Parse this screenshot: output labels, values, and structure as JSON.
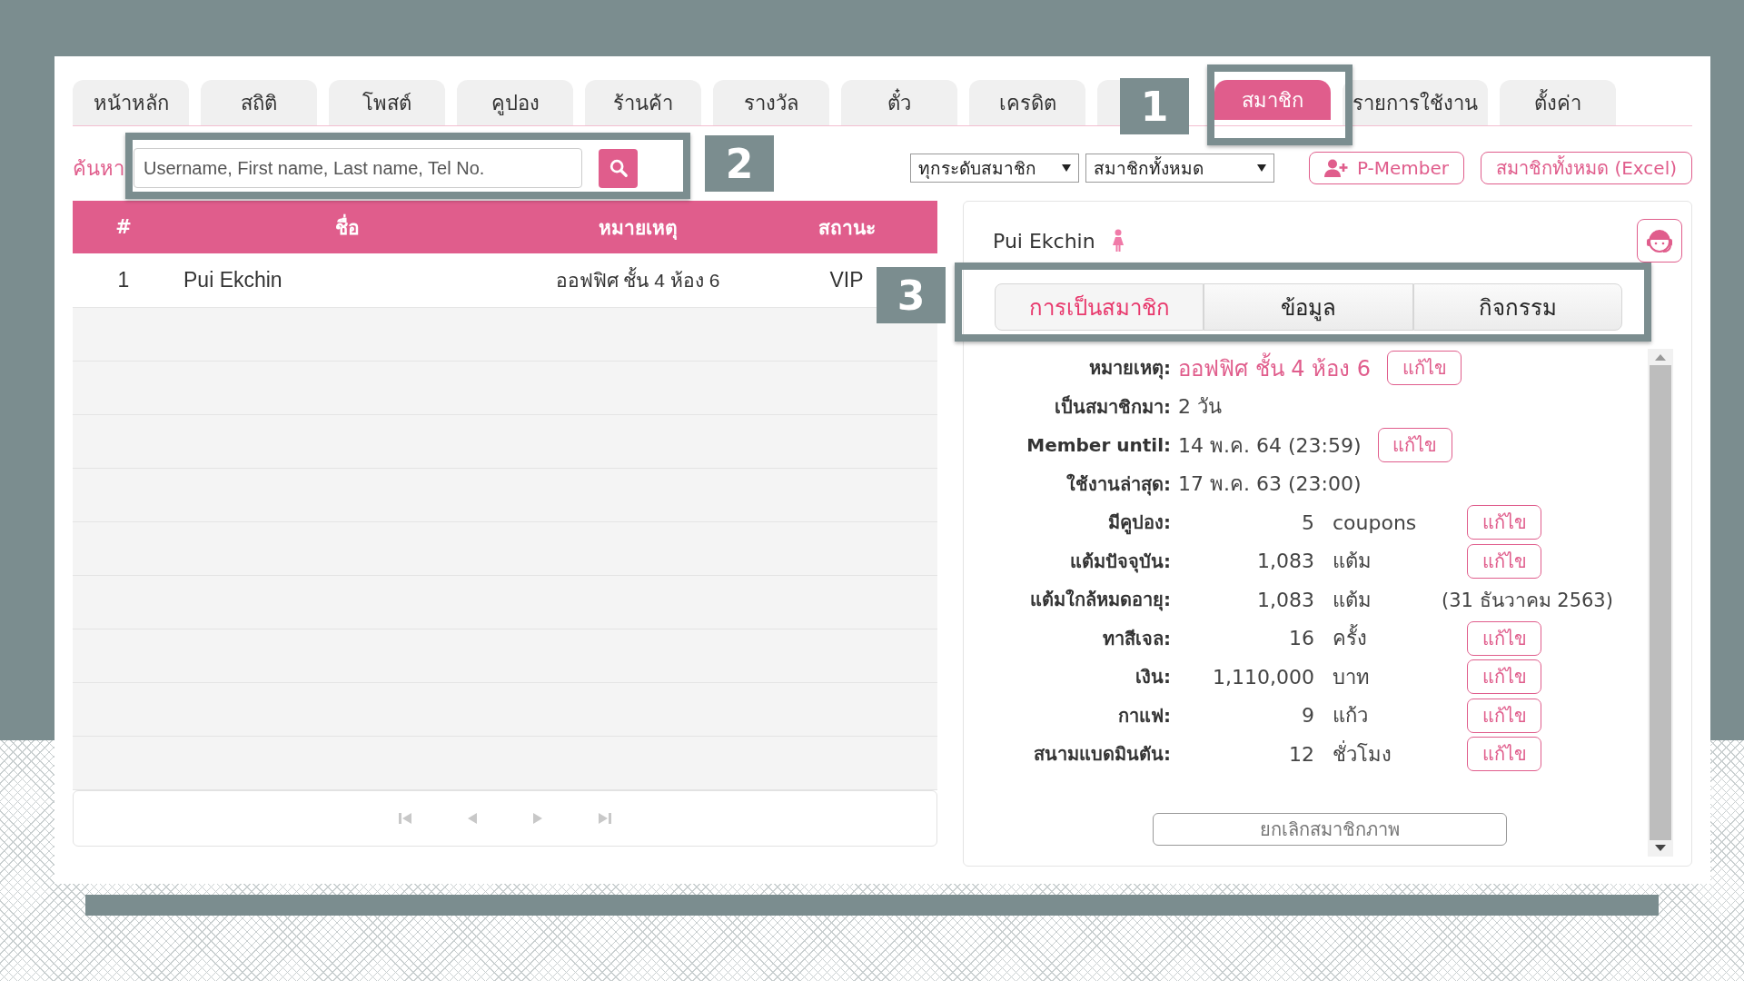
{
  "nav_tabs": [
    {
      "label": "หน้าหลัก",
      "selected": false
    },
    {
      "label": "สถิติ",
      "selected": false
    },
    {
      "label": "โพสต์",
      "selected": false
    },
    {
      "label": "คูปอง",
      "selected": false
    },
    {
      "label": "ร้านค้า",
      "selected": false
    },
    {
      "label": "รางวัล",
      "selected": false
    },
    {
      "label": "ตั๋ว",
      "selected": false
    },
    {
      "label": "เครดิต",
      "selected": false
    },
    {
      "covered": true,
      "selected": false
    },
    {
      "label": "สมาชิก",
      "selected": true
    },
    {
      "label": "รายการใช้งาน",
      "selected": false
    },
    {
      "label": "ตั้งค่า",
      "selected": false
    }
  ],
  "callouts": [
    {
      "number": "1"
    },
    {
      "number": "2"
    },
    {
      "number": "3"
    }
  ],
  "search": {
    "label": "ค้นหา",
    "placeholder": "Username, First name, Last name, Tel No."
  },
  "filters": [
    {
      "value": "ทุกระดับสมาชิก"
    },
    {
      "value": "สมาชิกทั้งหมด"
    }
  ],
  "buttons": [
    {
      "label": "P-Member",
      "kind": "add-user"
    },
    {
      "label": "สมาชิกทั้งหมด (Excel)",
      "kind": "plain"
    }
  ],
  "table": {
    "columns": [
      "#",
      "ชื่อ",
      "หมายเหตุ",
      "สถานะ"
    ],
    "rows": [
      [
        "1",
        "Pui Ekchin",
        "ออฟฟิศ ชั้น 4 ห้อง 6",
        "VIP"
      ]
    ]
  },
  "member": {
    "name": "Pui Ekchin",
    "tabs": [
      {
        "label": "การเป็นสมาชิก",
        "selected": true
      },
      {
        "label": "ข้อมูล",
        "selected": false
      },
      {
        "label": "กิจกรรม",
        "selected": false
      }
    ],
    "details": [
      {
        "kind": "inline",
        "label": "หมายเหตุ:",
        "value": "ออฟฟิศ ชั้น 4 ห้อง 6",
        "highlight": true,
        "edit": "แก้ไข"
      },
      {
        "kind": "inline",
        "label": "เป็นสมาชิกมา:",
        "value": "2 วัน",
        "highlight": false
      },
      {
        "kind": "inline",
        "label": "Member until:",
        "value": "14 พ.ค. 64 (23:59)",
        "highlight": false,
        "edit": "แก้ไข"
      },
      {
        "kind": "inline",
        "label": "ใช้งานล่าสุด:",
        "value": "17 พ.ค. 63 (23:00)",
        "highlight": false
      },
      {
        "kind": "balance",
        "label": "มีคูปอง:",
        "amount": "5",
        "unit": "coupons",
        "edit": "แก้ไข"
      },
      {
        "kind": "balance",
        "label": "แต้มปัจจุบัน:",
        "amount": "1,083",
        "unit": "แต้ม",
        "edit": "แก้ไข"
      },
      {
        "kind": "balance",
        "label": "แต้มใกล้หมดอายุ:",
        "amount": "1,083",
        "unit": "แต้ม",
        "note": "(31 ธันวาคม 2563)"
      },
      {
        "kind": "balance",
        "label": "ทาสีเจล:",
        "amount": "16",
        "unit": "ครั้ง",
        "edit": "แก้ไข"
      },
      {
        "kind": "balance",
        "label": "เงิน:",
        "amount": "1,110,000",
        "unit": "บาท",
        "edit": "แก้ไข"
      },
      {
        "kind": "balance",
        "label": "กาแฟ:",
        "amount": "9",
        "unit": "แก้ว",
        "edit": "แก้ไข"
      },
      {
        "kind": "balance",
        "label": "สนามแบดมินตัน:",
        "amount": "12",
        "unit": "ชั่วโมง",
        "edit": "แก้ไข"
      }
    ],
    "cancel_button": "ยกเลิกสมาชิกภาพ"
  }
}
